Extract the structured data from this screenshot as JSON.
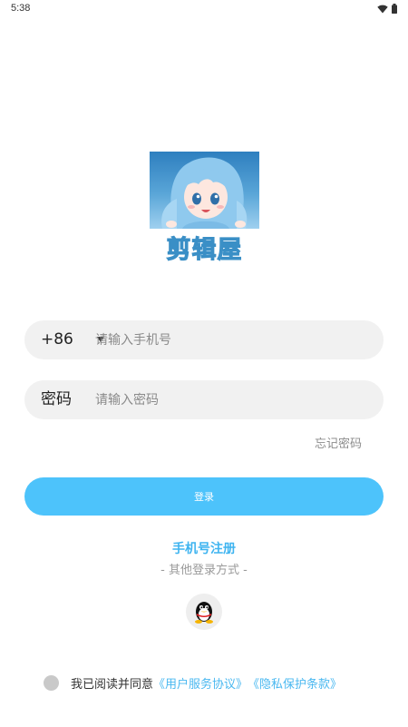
{
  "status_bar": {
    "time": "5:38"
  },
  "logo": {
    "text": "剪辑屋"
  },
  "phone_field": {
    "prefix": "+86",
    "placeholder": "请输入手机号",
    "value": ""
  },
  "password_field": {
    "label": "密码",
    "placeholder": "请输入密码",
    "value": ""
  },
  "forgot_password": "忘记密码",
  "login_button": "登录",
  "register_link": "手机号注册",
  "other_login": "- 其他登录方式 -",
  "agreement": {
    "prefix": "我已阅读并同意",
    "user_agreement": "《用户服务协议》",
    "privacy_policy": "《隐私保护条款》"
  },
  "colors": {
    "accent": "#4dc3fb",
    "link": "#4ab8f0"
  }
}
